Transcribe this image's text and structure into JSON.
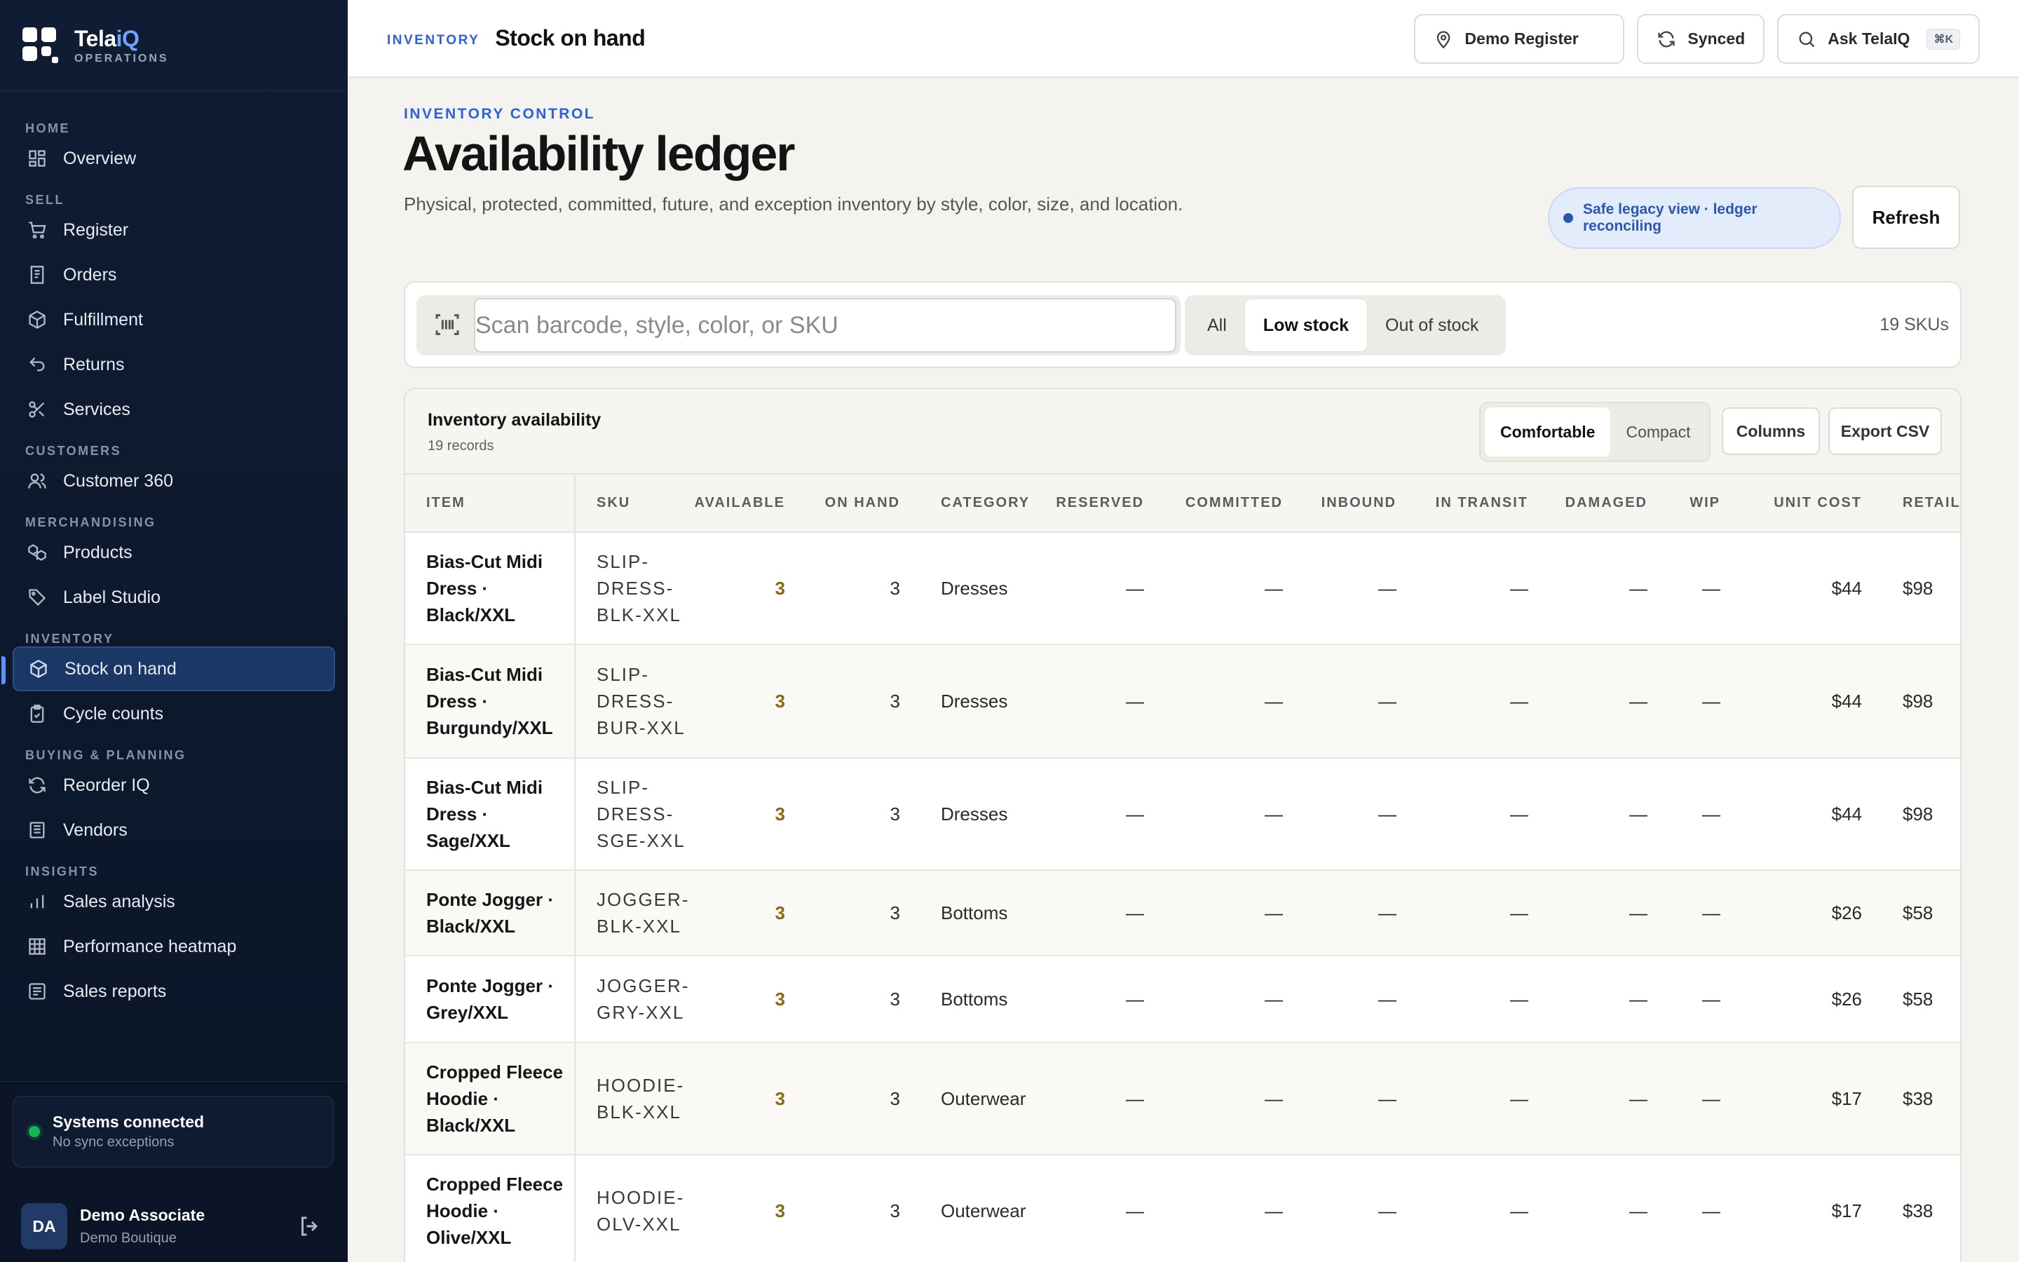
{
  "brand": {
    "name_main": "Tela",
    "name_accent": "iQ",
    "subtitle": "OPERATIONS"
  },
  "nav": {
    "home": "HOME",
    "overview": "Overview",
    "sell": "SELL",
    "register": "Register",
    "orders": "Orders",
    "fulfillment": "Fulfillment",
    "returns": "Returns",
    "services": "Services",
    "customers": "CUSTOMERS",
    "customer360": "Customer 360",
    "merchandising": "MERCHANDISING",
    "products": "Products",
    "label_studio": "Label Studio",
    "inventory": "INVENTORY",
    "stock_on_hand": "Stock on hand",
    "cycle_counts": "Cycle counts",
    "buying": "BUYING & PLANNING",
    "reorder_iq": "Reorder IQ",
    "vendors": "Vendors",
    "insights": "INSIGHTS",
    "sales_analysis": "Sales analysis",
    "performance_heatmap": "Performance heatmap",
    "sales_reports": "Sales reports"
  },
  "system": {
    "title": "Systems connected",
    "subtitle": "No sync exceptions"
  },
  "user": {
    "initials": "DA",
    "name": "Demo Associate",
    "org": "Demo Boutique"
  },
  "topbar": {
    "crumb": "INVENTORY",
    "title": "Stock on hand",
    "register": "Demo Register",
    "synced": "Synced",
    "ask": "Ask TelaIQ",
    "shortcut": "⌘K"
  },
  "page": {
    "eyebrow": "INVENTORY CONTROL",
    "title": "Availability ledger",
    "description": "Physical, protected, committed, future, and exception inventory by style, color, size, and location.",
    "status": "Safe legacy view · ledger reconciling",
    "refresh": "Refresh"
  },
  "filters": {
    "placeholder": "Scan barcode, style, color, or SKU",
    "all": "All",
    "low": "Low stock",
    "out": "Out of stock",
    "count": "19 SKUs"
  },
  "table": {
    "title": "Inventory availability",
    "records": "19 records",
    "comfortable": "Comfortable",
    "compact": "Compact",
    "columns_btn": "Columns",
    "export": "Export CSV",
    "columns": [
      "ITEM",
      "SKU",
      "AVAILABLE",
      "ON HAND",
      "CATEGORY",
      "RESERVED",
      "COMMITTED",
      "INBOUND",
      "IN TRANSIT",
      "DAMAGED",
      "WIP",
      "UNIT COST",
      "RETAIL"
    ],
    "rows": [
      {
        "item": "Bias-Cut Midi Dress · Black/XXL",
        "sku": "SLIP-DRESS-BLK-XXL",
        "available": "3",
        "on_hand": "3",
        "category": "Dresses",
        "reserved": "—",
        "committed": "—",
        "inbound": "—",
        "in_transit": "—",
        "damaged": "—",
        "wip": "—",
        "unit_cost": "$44",
        "retail": "$98"
      },
      {
        "item": "Bias-Cut Midi Dress · Burgundy/XXL",
        "sku": "SLIP-DRESS-BUR-XXL",
        "available": "3",
        "on_hand": "3",
        "category": "Dresses",
        "reserved": "—",
        "committed": "—",
        "inbound": "—",
        "in_transit": "—",
        "damaged": "—",
        "wip": "—",
        "unit_cost": "$44",
        "retail": "$98"
      },
      {
        "item": "Bias-Cut Midi Dress · Sage/XXL",
        "sku": "SLIP-DRESS-SGE-XXL",
        "available": "3",
        "on_hand": "3",
        "category": "Dresses",
        "reserved": "—",
        "committed": "—",
        "inbound": "—",
        "in_transit": "—",
        "damaged": "—",
        "wip": "—",
        "unit_cost": "$44",
        "retail": "$98"
      },
      {
        "item": "Ponte Jogger · Black/XXL",
        "sku": "JOGGER-BLK-XXL",
        "available": "3",
        "on_hand": "3",
        "category": "Bottoms",
        "reserved": "—",
        "committed": "—",
        "inbound": "—",
        "in_transit": "—",
        "damaged": "—",
        "wip": "—",
        "unit_cost": "$26",
        "retail": "$58"
      },
      {
        "item": "Ponte Jogger · Grey/XXL",
        "sku": "JOGGER-GRY-XXL",
        "available": "3",
        "on_hand": "3",
        "category": "Bottoms",
        "reserved": "—",
        "committed": "—",
        "inbound": "—",
        "in_transit": "—",
        "damaged": "—",
        "wip": "—",
        "unit_cost": "$26",
        "retail": "$58"
      },
      {
        "item": "Cropped Fleece Hoodie · Black/XXL",
        "sku": "HOODIE-BLK-XXL",
        "available": "3",
        "on_hand": "3",
        "category": "Outerwear",
        "reserved": "—",
        "committed": "—",
        "inbound": "—",
        "in_transit": "—",
        "damaged": "—",
        "wip": "—",
        "unit_cost": "$17",
        "retail": "$38"
      },
      {
        "item": "Cropped Fleece Hoodie · Olive/XXL",
        "sku": "HOODIE-OLV-XXL",
        "available": "3",
        "on_hand": "3",
        "category": "Outerwear",
        "reserved": "—",
        "committed": "—",
        "inbound": "—",
        "in_transit": "—",
        "damaged": "—",
        "wip": "—",
        "unit_cost": "$17",
        "retail": "$38"
      }
    ]
  }
}
